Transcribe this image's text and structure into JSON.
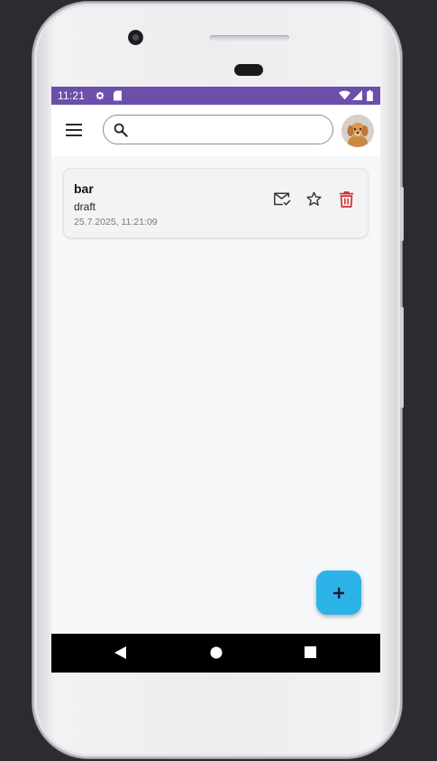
{
  "status_bar": {
    "time": "11:21",
    "left_icons": [
      "settings-icon",
      "sd-card-icon"
    ],
    "right_icons": [
      "wifi-icon",
      "signal-icon",
      "battery-icon"
    ],
    "background": "#6b4fab"
  },
  "app_bar": {
    "menu_icon": "hamburger-menu-icon",
    "search": {
      "icon": "search-icon",
      "value": "",
      "placeholder": ""
    },
    "avatar": "puppy-avatar"
  },
  "notes": [
    {
      "title": "bar",
      "status": "draft",
      "timestamp": "25.7.2025, 11:21:09",
      "actions": [
        "mark-read-icon",
        "star-icon",
        "delete-icon"
      ]
    }
  ],
  "fab": {
    "icon": "plus-icon",
    "color": "#2bb3e8"
  },
  "nav_bar": {
    "icons": [
      "back-icon",
      "home-icon",
      "recents-icon"
    ]
  },
  "colors": {
    "delete": "#d32f2f",
    "accent": "#2bb3e8"
  }
}
